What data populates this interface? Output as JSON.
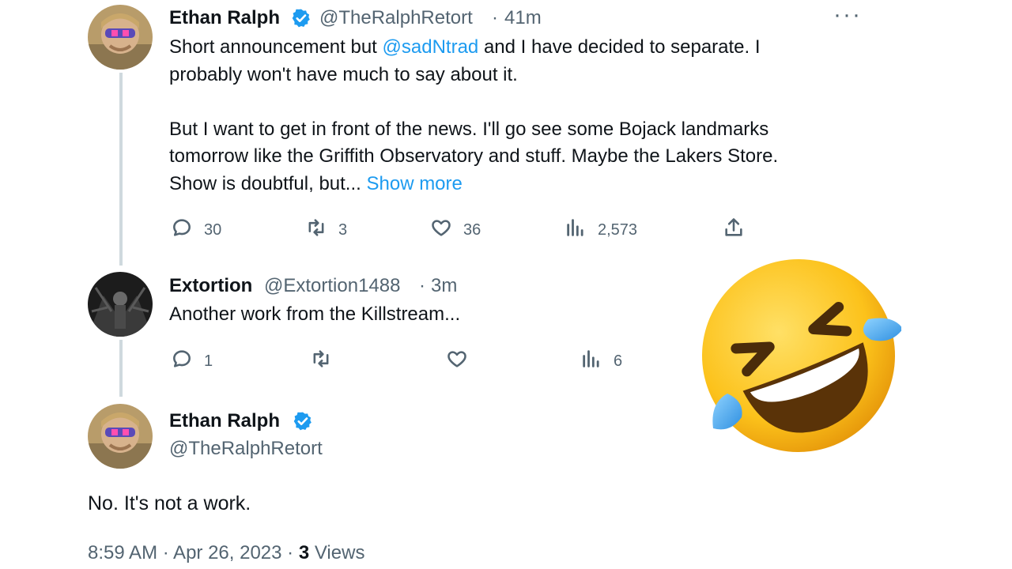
{
  "tweet1": {
    "name": "Ethan Ralph",
    "handle": "@TheRalphRetort",
    "time": "41m",
    "text_1": "Short announcement but ",
    "mention": "@sadNtrad",
    "text_2": " and I have decided to separate. I\nprobably won't have much to say about it.\n\nBut I want to get in front of the news. I'll go see some Bojack landmarks\ntomorrow like the Griffith Observatory and stuff. Maybe the Lakers Store.\nShow is doubtful, but... ",
    "show_more": "Show more",
    "replies": "30",
    "retweets": "3",
    "likes": "36",
    "views": "2,573"
  },
  "tweet2": {
    "name": "Extortion",
    "handle": "@Extortion1488",
    "time": "3m",
    "text": "Another work from the Killstream...",
    "replies": "1",
    "views": "6"
  },
  "tweet3": {
    "name": "Ethan Ralph",
    "handle": "@TheRalphRetort",
    "text": "No. It's not a work.",
    "timestamp": "8:59 AM · Apr 26, 2023 · ",
    "views_count": "3",
    "views_label": " Views"
  },
  "icons": {
    "verified": "verified-badge-icon",
    "reply": "reply-icon",
    "retweet": "retweet-icon",
    "like": "like-icon",
    "views": "views-icon",
    "share": "share-icon",
    "more": "more-icon",
    "emoji": "rolling-on-floor-laughing-emoji"
  },
  "colors": {
    "link": "#1d9bf0",
    "secondary": "#536471",
    "thread_line": "#cfd9de"
  }
}
